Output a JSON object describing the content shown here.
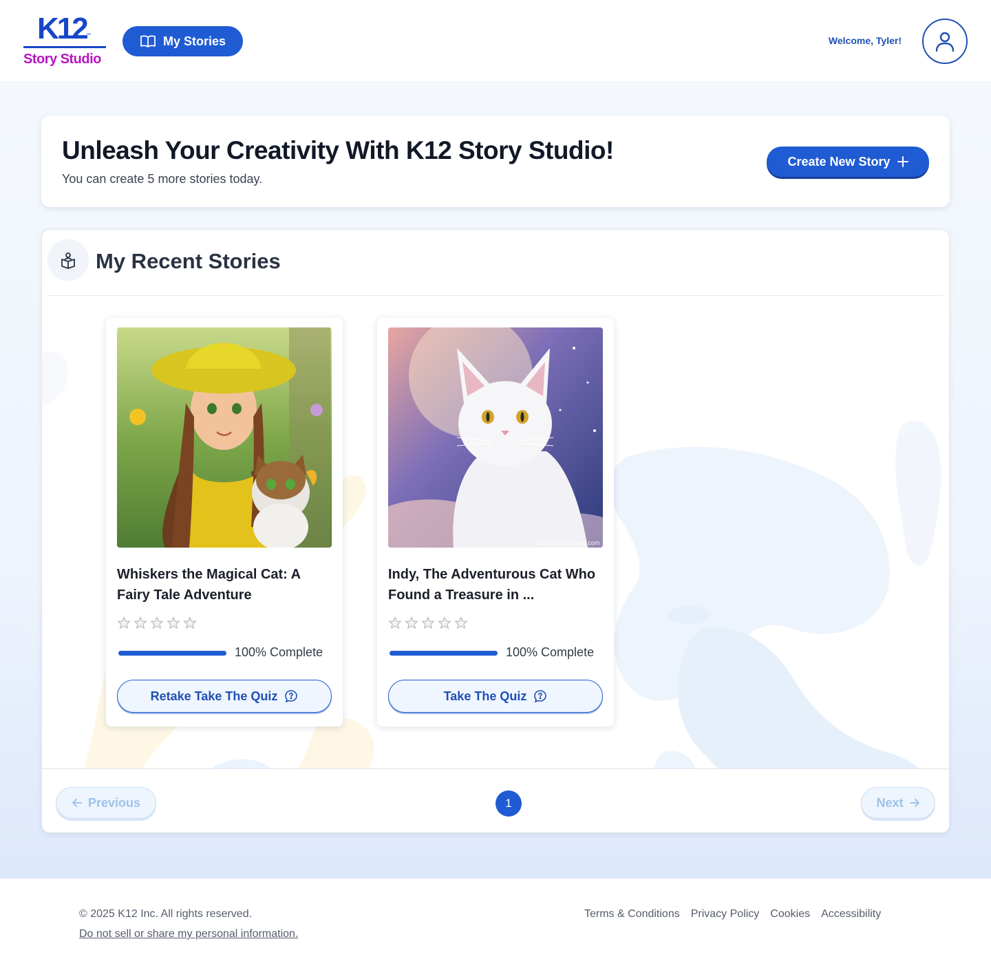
{
  "header": {
    "logo_k12": "K12",
    "logo_tm": "™",
    "logo_studio": "Story Studio",
    "nav_my_stories": "My Stories",
    "welcome": "Welcome, Tyler!"
  },
  "hero": {
    "title": "Unleash Your Creativity With K12 Story Studio!",
    "subtitle": "You can create 5 more stories today.",
    "create_button": "Create New Story"
  },
  "recent": {
    "title": "My Recent Stories",
    "stories": [
      {
        "title": "Whiskers the Magical Cat: A Fairy Tale Adventure",
        "rating": 0,
        "max_rating": 5,
        "progress_percent": 100,
        "progress_label": "100% Complete",
        "quiz_button": "Retake Take The Quiz"
      },
      {
        "title": "Indy, The Adventurous Cat Who Found a Treasure in ...",
        "rating": 0,
        "max_rating": 5,
        "progress_percent": 100,
        "progress_label": "100% Complete",
        "quiz_button": "Take The Quiz",
        "image_watermark": "stablediffusionweb.com"
      }
    ]
  },
  "pagination": {
    "previous": "Previous",
    "next": "Next",
    "current_page": "1"
  },
  "footer": {
    "copyright": "© 2025 K12 Inc. All rights reserved.",
    "do_not_sell": "Do not sell or share my personal information.",
    "links": [
      "Terms & Conditions",
      "Privacy Policy",
      "Cookies",
      "Accessibility"
    ]
  },
  "colors": {
    "brand_blue": "#1f5bd3",
    "brand_magenta": "#b516c0",
    "text_dark": "#1b1f2a"
  },
  "icons": {
    "nav": "open-book-icon",
    "avatar": "user-icon",
    "create": "plus-icon",
    "section": "book-reader-icon",
    "quiz": "question-bubble-icon",
    "prev": "arrow-left-icon",
    "next": "arrow-right-icon",
    "rating": "star-outline-icon"
  }
}
